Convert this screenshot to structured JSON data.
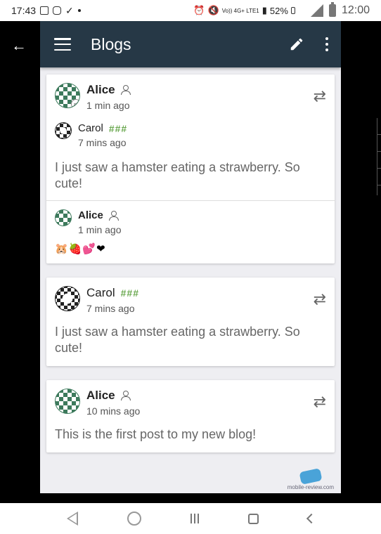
{
  "statusbar": {
    "left_time": "17:43",
    "network_text": "Vo)) 4G+ LTE1",
    "battery_percent": "52%",
    "right_time": "12:00"
  },
  "toolbar": {
    "title": "Blogs",
    "menu_icon": "hamburger-icon",
    "edit_icon": "pencil-icon",
    "more_icon": "kebab-icon"
  },
  "posts": [
    {
      "author": "Alice",
      "time": "1 min ago",
      "quoted": {
        "author": "Carol",
        "tag": "###",
        "time": "7 mins ago",
        "text": "I just saw a hamster eating a strawberry. So cute!"
      },
      "reply": {
        "author": "Alice",
        "time": "1 min ago",
        "text": "🐹🍓💕❤"
      }
    },
    {
      "author": "Carol",
      "tag": "###",
      "time": "7 mins ago",
      "text": "I just saw a hamster eating a strawberry. So cute!"
    },
    {
      "author": "Alice",
      "time": "10 mins ago",
      "text": "This is the first post to my new blog!"
    }
  ],
  "watermark": "mobile-review.com",
  "colors": {
    "toolbar_bg": "#263846",
    "tag_green": "#6aa84f",
    "background": "#eeeef2"
  }
}
